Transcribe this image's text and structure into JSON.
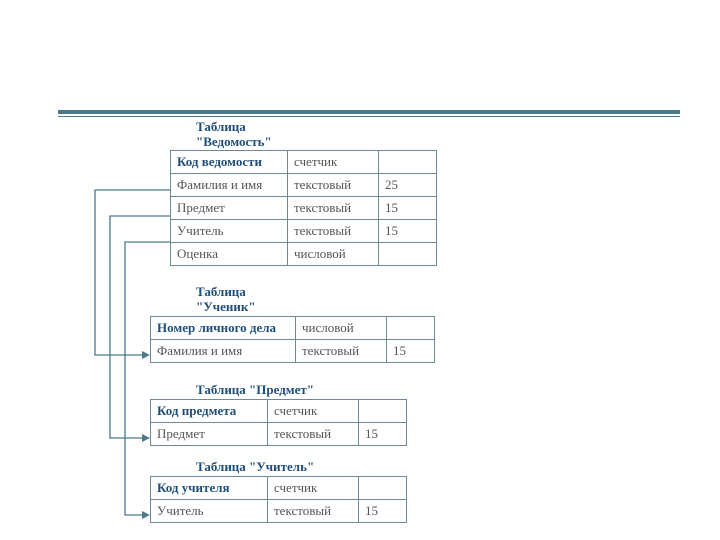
{
  "captions": {
    "t1": "Таблица\n\"Ведомость\"",
    "t2": "Таблица\n\"Ученик\"",
    "t3": "Таблица \"Предмет\"",
    "t4": "Таблица \"Учитель\""
  },
  "tables": {
    "t1": {
      "rows": [
        {
          "name": "Код ведомости",
          "type": "счетчик",
          "size": "",
          "key": true
        },
        {
          "name": "Фамилия и имя",
          "type": "текстовый",
          "size": "25",
          "key": false
        },
        {
          "name": "Предмет",
          "type": "текстовый",
          "size": "15",
          "key": false
        },
        {
          "name": "Учитель",
          "type": "текстовый",
          "size": "15",
          "key": false
        },
        {
          "name": "Оценка",
          "type": "числовой",
          "size": "",
          "key": false
        }
      ]
    },
    "t2": {
      "rows": [
        {
          "name": "Номер личного дела",
          "type": "числовой",
          "size": "",
          "key": true
        },
        {
          "name": "Фамилия и имя",
          "type": "текстовый",
          "size": "15",
          "key": false
        }
      ]
    },
    "t3": {
      "rows": [
        {
          "name": "Код предмета",
          "type": "счетчик",
          "size": "",
          "key": true
        },
        {
          "name": "Предмет",
          "type": "текстовый",
          "size": "15",
          "key": false
        }
      ]
    },
    "t4": {
      "rows": [
        {
          "name": "Код учителя",
          "type": "счетчик",
          "size": "",
          "key": true
        },
        {
          "name": "Учитель",
          "type": "текстовый",
          "size": "15",
          "key": false
        }
      ]
    }
  }
}
